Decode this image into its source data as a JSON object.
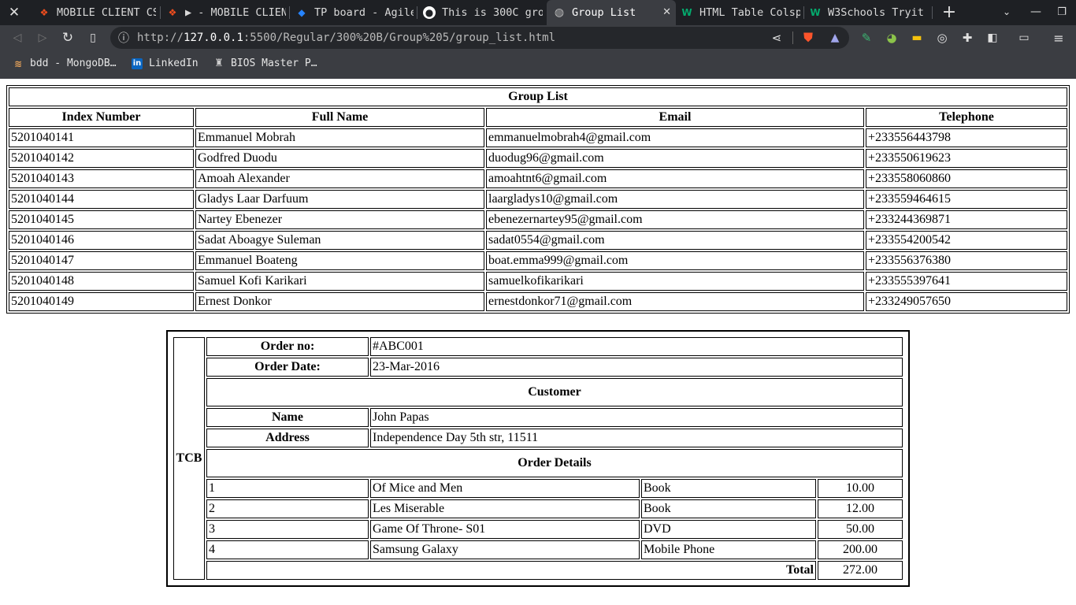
{
  "browser": {
    "tabs": [
      {
        "label": "MOBILE CLIENT CS",
        "icon": "figma-icon"
      },
      {
        "label": "▶ - MOBILE CLIEN",
        "icon": "figma-icon"
      },
      {
        "label": "TP board - Agile",
        "icon": "jira-icon"
      },
      {
        "label": "This is 300C gro",
        "icon": "github-icon"
      },
      {
        "label": "Group List",
        "icon": "globe-icon",
        "active": true
      },
      {
        "label": "HTML Table Colsp",
        "icon": "w3schools-icon"
      },
      {
        "label": "W3Schools Tryit",
        "icon": "w3schools-icon"
      }
    ],
    "url_prefix": "http://",
    "url_host": "127.0.0.1",
    "url_rest": ":5500/Regular/300%20B/Group%205/group_list.html",
    "bookmarks": [
      {
        "label": "bdd - MongoDB…",
        "icon": "mongodb-icon"
      },
      {
        "label": "LinkedIn",
        "icon": "linkedin-icon"
      },
      {
        "label": "BIOS Master P…",
        "icon": "bios-icon"
      }
    ]
  },
  "group_list": {
    "caption": "Group List",
    "headers": [
      "Index Number",
      "Full Name",
      "Email",
      "Telephone"
    ],
    "rows": [
      [
        "5201040141",
        "Emmanuel Mobrah",
        "emmanuelmobrah4@gmail.com",
        "+233556443798"
      ],
      [
        "5201040142",
        "Godfred Duodu",
        "duodug96@gmail.com",
        "+233550619623"
      ],
      [
        "5201040143",
        "Amoah Alexander",
        "amoahtnt6@gmail.com",
        "+233558060860"
      ],
      [
        "5201040144",
        "Gladys Laar Darfuum",
        "laargladys10@gmail.com",
        "+233559464615"
      ],
      [
        "5201040145",
        "Nartey Ebenezer",
        "ebenezernartey95@gmail.com",
        "+233244369871"
      ],
      [
        "5201040146",
        "Sadat Aboagye Suleman",
        "sadat0554@gmail.com",
        "+233554200542"
      ],
      [
        "5201040147",
        "Emmanuel Boateng",
        "boat.emma999@gmail.com",
        "+233556376380"
      ],
      [
        "5201040148",
        "Samuel Kofi Karikari",
        "samuelkofikarikari",
        "+233555397641"
      ],
      [
        "5201040149",
        "Ernest Donkor",
        "ernestdonkor71@gmail.com",
        "+233249057650"
      ]
    ]
  },
  "order": {
    "side_label": "TCB",
    "order_no_label": "Order no:",
    "order_no": "#ABC001",
    "order_date_label": "Order Date:",
    "order_date": "23-Mar-2016",
    "customer_heading": "Customer",
    "name_label": "Name",
    "name": "John Papas",
    "address_label": "Address",
    "address": "Independence Day 5th str, 11511",
    "details_heading": "Order Details",
    "items": [
      [
        "1",
        "Of Mice and Men",
        "Book",
        "10.00"
      ],
      [
        "2",
        "Les Miserable",
        "Book",
        "12.00"
      ],
      [
        "3",
        "Game Of Throne- S01",
        "DVD",
        "50.00"
      ],
      [
        "4",
        "Samsung Galaxy",
        "Mobile Phone",
        "200.00"
      ]
    ],
    "total_label": "Total",
    "total": "272.00"
  }
}
